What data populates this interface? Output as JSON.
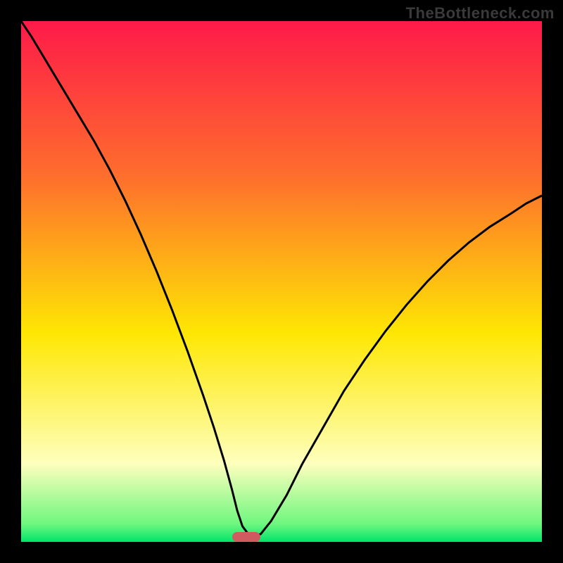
{
  "watermark": "TheBottleneck.com",
  "colors": {
    "top": "#fe1a49",
    "orange": "#fe6f2c",
    "yellow": "#fee703",
    "pale": "#feffbd",
    "green": "#02e46b",
    "curve": "#000000",
    "marker": "#cf5b61",
    "frame": "#000000"
  },
  "chart_data": {
    "type": "line",
    "title": "",
    "xlabel": "",
    "ylabel": "",
    "xlim": [
      0,
      100
    ],
    "ylim": [
      0,
      100
    ],
    "x": [
      0,
      2,
      5,
      8,
      11,
      14,
      17,
      20,
      23,
      26,
      29,
      32,
      35,
      37,
      39,
      40.5,
      41.5,
      42.5,
      44,
      46,
      48,
      51,
      54,
      58,
      62,
      66,
      70,
      74,
      78,
      82,
      86,
      90,
      94,
      97,
      100
    ],
    "y": [
      100,
      97,
      92,
      87,
      82,
      77,
      71.5,
      65.5,
      59,
      52,
      44.5,
      36.5,
      28,
      22,
      15.5,
      10,
      6,
      3,
      1,
      1.5,
      4,
      9,
      15,
      22,
      29,
      35,
      40.5,
      45.5,
      50,
      54,
      57.5,
      60.5,
      63,
      65,
      66.5
    ],
    "minimum_x": 43,
    "marker": {
      "x_start": 40.5,
      "x_end": 46,
      "y": 1
    },
    "gradient_stops": [
      {
        "offset": 0.0,
        "color": "#fe1a49"
      },
      {
        "offset": 0.3,
        "color": "#fe6f2c"
      },
      {
        "offset": 0.6,
        "color": "#fee703"
      },
      {
        "offset": 0.85,
        "color": "#feffbd"
      },
      {
        "offset": 0.965,
        "color": "#6ff77f"
      },
      {
        "offset": 1.0,
        "color": "#02e46b"
      }
    ]
  }
}
